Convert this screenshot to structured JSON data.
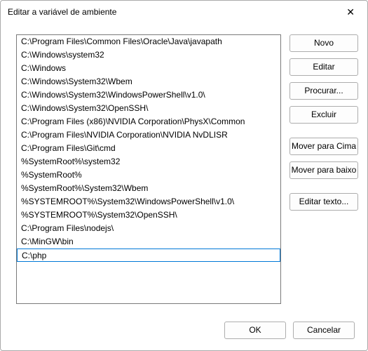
{
  "window": {
    "title": "Editar a variável de ambiente"
  },
  "list": {
    "items": [
      "C:\\Program Files\\Common Files\\Oracle\\Java\\javapath",
      "C:\\Windows\\system32",
      "C:\\Windows",
      "C:\\Windows\\System32\\Wbem",
      "C:\\Windows\\System32\\WindowsPowerShell\\v1.0\\",
      "C:\\Windows\\System32\\OpenSSH\\",
      "C:\\Program Files (x86)\\NVIDIA Corporation\\PhysX\\Common",
      "C:\\Program Files\\NVIDIA Corporation\\NVIDIA NvDLISR",
      "C:\\Program Files\\Git\\cmd",
      "%SystemRoot%\\system32",
      "%SystemRoot%",
      "%SystemRoot%\\System32\\Wbem",
      "%SYSTEMROOT%\\System32\\WindowsPowerShell\\v1.0\\",
      "%SYSTEMROOT%\\System32\\OpenSSH\\",
      "C:\\Program Files\\nodejs\\",
      "C:\\MinGW\\bin"
    ],
    "editing_value": "C:\\php"
  },
  "buttons": {
    "new": "Novo",
    "edit": "Editar",
    "browse": "Procurar...",
    "delete": "Excluir",
    "move_up": "Mover para Cima",
    "move_down": "Mover para baixo",
    "edit_text": "Editar texto...",
    "ok": "OK",
    "cancel": "Cancelar"
  }
}
